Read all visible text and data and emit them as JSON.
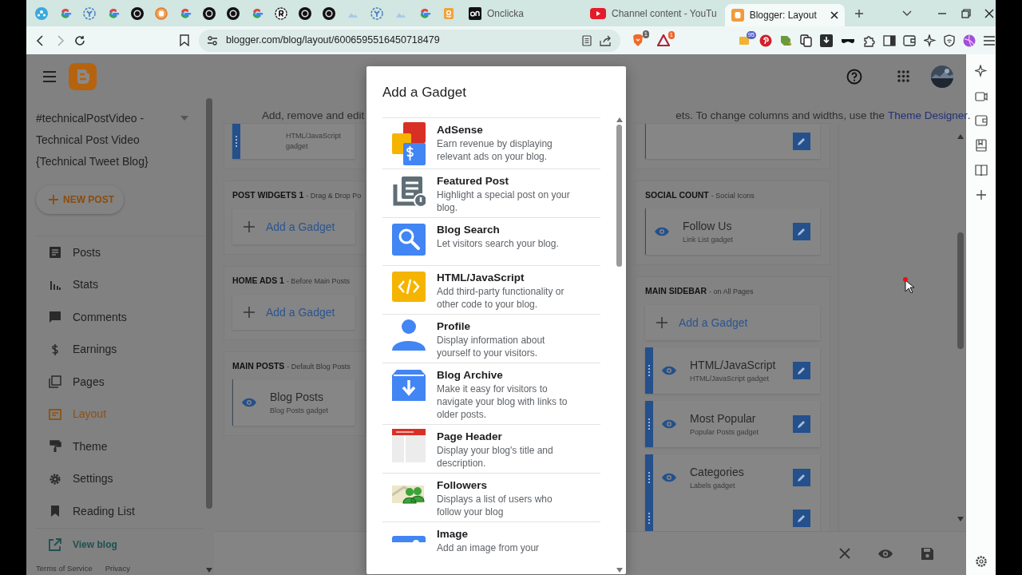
{
  "browser": {
    "tabs": [
      {
        "title": "Onclicka",
        "selected": false
      },
      {
        "title": "Channel content - YouTu",
        "selected": false
      },
      {
        "title": "Blogger: Layout",
        "selected": true
      }
    ],
    "url": "blogger.com/blog/layout/6006595516450718479",
    "badges": [
      "1",
      "1",
      "95"
    ]
  },
  "blogger": {
    "blog_title": "#technicalPostVideo - Technical Post Video {Technical Tweet Blog}",
    "new_post": "NEW POST",
    "nav": [
      {
        "label": "Posts",
        "selected": false
      },
      {
        "label": "Stats",
        "selected": false
      },
      {
        "label": "Comments",
        "selected": false
      },
      {
        "label": "Earnings",
        "selected": false
      },
      {
        "label": "Pages",
        "selected": false
      },
      {
        "label": "Layout",
        "selected": true
      },
      {
        "label": "Theme",
        "selected": false
      },
      {
        "label": "Settings",
        "selected": false
      },
      {
        "label": "Reading List",
        "selected": false
      }
    ],
    "view_blog": "View blog",
    "footer_links": [
      "Terms of Service",
      "Privacy"
    ]
  },
  "layout": {
    "intro_left": "Add, remove and edit",
    "intro_right": "ets. To change columns and widths, use the",
    "intro_link": "Theme Designer",
    "intro_end": ".",
    "left_column": [
      {
        "gadgets": [
          {
            "subtitle": "HTML/JavaScript gadget",
            "draggable": true
          }
        ]
      },
      {
        "title": "POST WIDGETS 1",
        "note": "- Drag & Drop Po",
        "add": "Add a Gadget"
      },
      {
        "title": "HOME ADS 1",
        "note": "- Before Main Posts",
        "add": "Add a Gadget"
      },
      {
        "title": "MAIN POSTS",
        "note": "- Default Blog Posts",
        "gadgets": [
          {
            "name": "Blog Posts",
            "subtitle": "Blog Posts gadget",
            "draggable": false
          }
        ]
      }
    ],
    "right_column": [
      {
        "gadgets": [
          {
            "draggable": false
          }
        ]
      },
      {
        "title": "SOCIAL COUNT",
        "note": "- Social Icons",
        "gadgets": [
          {
            "name": "Follow Us",
            "subtitle": "Link List gadget",
            "draggable": false
          }
        ]
      },
      {
        "title": "MAIN SIDEBAR",
        "note": "- on All Pages",
        "add": "Add a Gadget",
        "gadgets": [
          {
            "name": "HTML/JavaScript",
            "subtitle": "HTML/JavaScript gadget",
            "draggable": true
          },
          {
            "name": "Most Popular",
            "subtitle": "Popular Posts gadget",
            "draggable": true
          },
          {
            "name": "Categories",
            "subtitle": "Labels gadget",
            "draggable": true
          },
          {
            "draggable": true
          }
        ]
      }
    ]
  },
  "dialog": {
    "title": "Add a Gadget",
    "gadgets": [
      {
        "name": "AdSense",
        "description": "Earn revenue by displaying relevant ads on your blog."
      },
      {
        "name": "Featured Post",
        "description": "Highlight a special post on your blog."
      },
      {
        "name": "Blog Search",
        "description": "Let visitors search your blog."
      },
      {
        "name": "HTML/JavaScript",
        "description": "Add third-party functionality or other code to your blog."
      },
      {
        "name": "Profile",
        "description": "Display information about yourself to your visitors."
      },
      {
        "name": "Blog Archive",
        "description": "Make it easy for visitors to navigate your blog with links to older posts."
      },
      {
        "name": "Page Header",
        "description": "Display your blog's title and description."
      },
      {
        "name": "Followers",
        "description": "Displays a list of users who follow your blog"
      },
      {
        "name": "Image",
        "description": "Add an image from your"
      }
    ]
  }
}
